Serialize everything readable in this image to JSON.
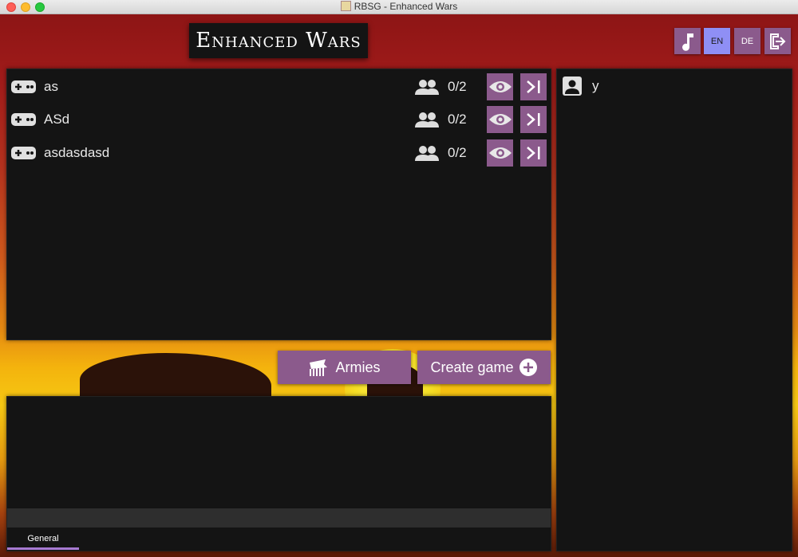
{
  "window": {
    "title": "RBSG - Enhanced Wars"
  },
  "header": {
    "logo_text": "Enhanced Wars",
    "buttons": [
      {
        "name": "music",
        "icon": "music-note-icon"
      },
      {
        "name": "lang-en",
        "label": "EN",
        "active": true
      },
      {
        "name": "lang-de",
        "label": "DE"
      },
      {
        "name": "logout",
        "icon": "logout-icon"
      }
    ]
  },
  "games": [
    {
      "name": "as",
      "players": "0/2"
    },
    {
      "name": "ASd",
      "players": "0/2"
    },
    {
      "name": "asdasdasd",
      "players": "0/2"
    }
  ],
  "players": [
    {
      "name": "y"
    }
  ],
  "actions": {
    "armies_label": "Armies",
    "create_game_label": "Create game"
  },
  "chat": {
    "input_value": "",
    "tabs": [
      {
        "label": "General",
        "active": true
      }
    ]
  },
  "colors": {
    "accent": "#8b5a8c",
    "active_lang": "#8f8ff5",
    "panel": "#141414"
  }
}
